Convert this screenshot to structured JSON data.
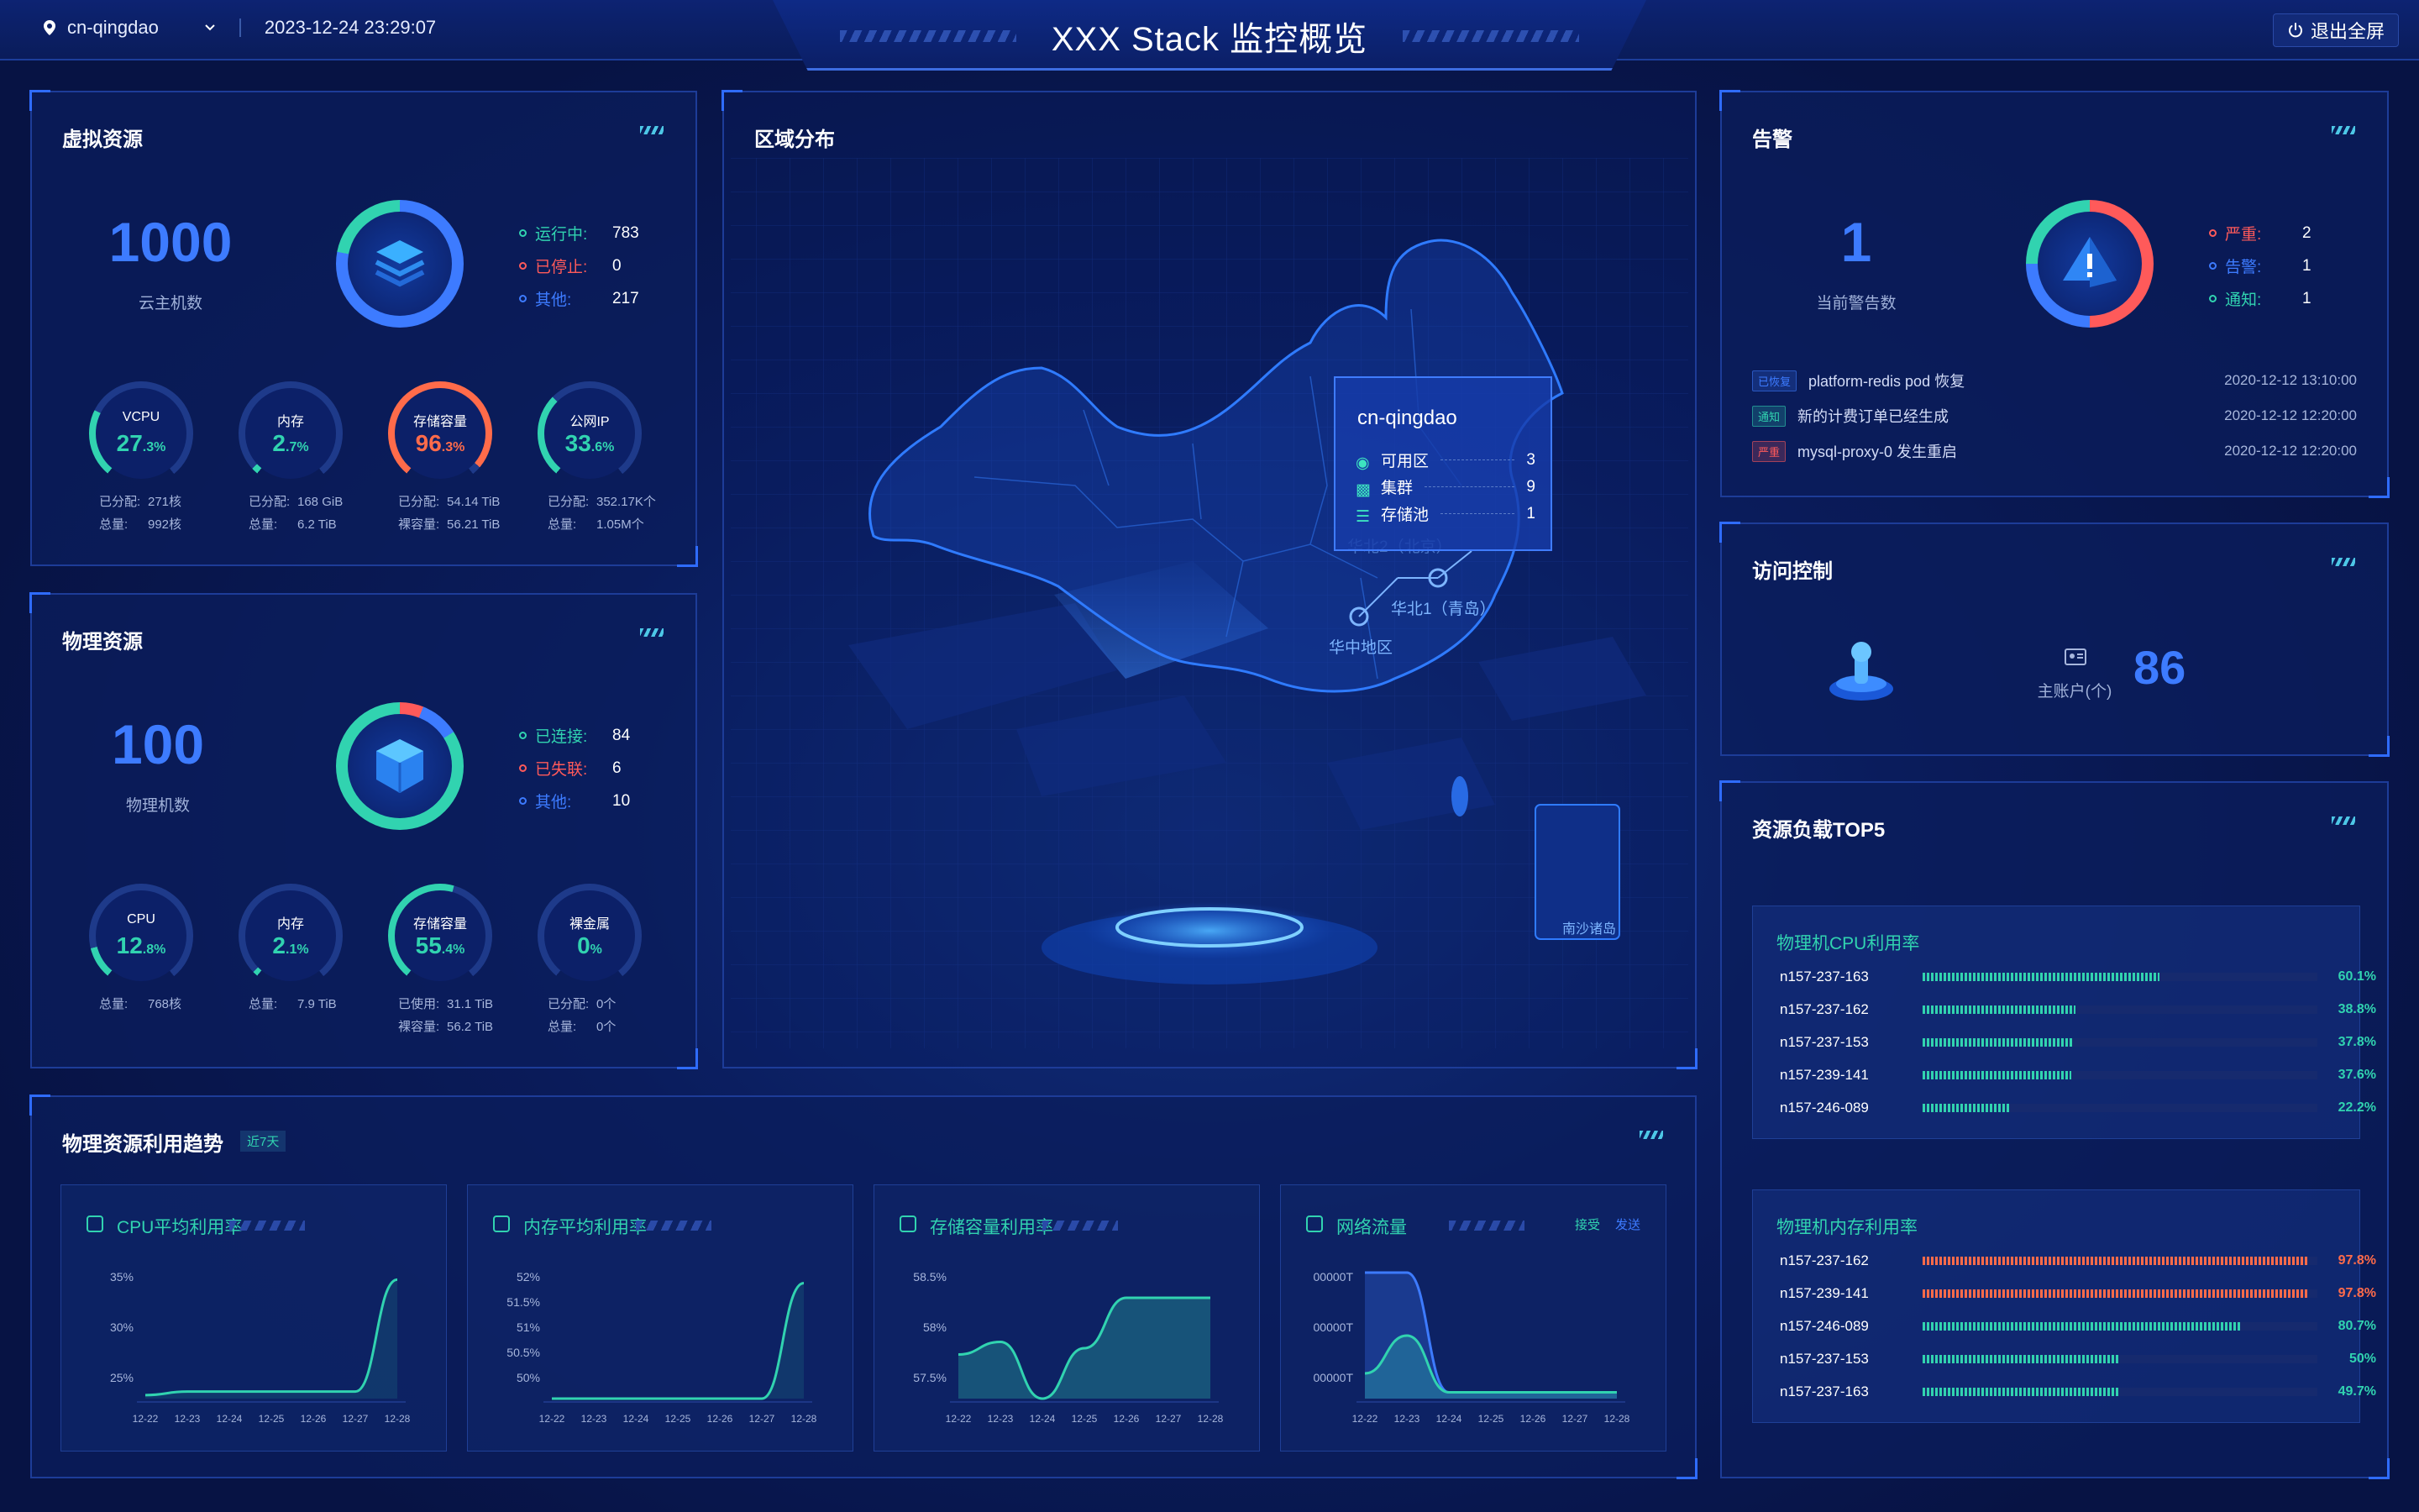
{
  "header": {
    "location": "cn-qingdao",
    "datetime": "2023-12-24 23:29:07",
    "title": "XXX Stack 监控概览",
    "exit_label": "退出全屏"
  },
  "virtual": {
    "title": "虚拟资源",
    "total": "1000",
    "total_caption": "云主机数",
    "stats": [
      {
        "label": "运行中:",
        "value": "783",
        "color": "#31d3b0"
      },
      {
        "label": "已停止:",
        "value": "0",
        "color": "#ff5a5a"
      },
      {
        "label": "其他:",
        "value": "217",
        "color": "#3d7bff"
      }
    ],
    "gauges": [
      {
        "label": "VCPU",
        "int": "27",
        "dec": ".3%",
        "pct": 27.3,
        "color": "#31d3b0",
        "n1k": "已分配:",
        "n1v": "271核",
        "n2k": "总量:",
        "n2v": "992核"
      },
      {
        "label": "内存",
        "int": "2",
        "dec": ".7%",
        "pct": 2.7,
        "color": "#31d3b0",
        "n1k": "已分配:",
        "n1v": "168 GiB",
        "n2k": "总量:",
        "n2v": "6.2 TiB"
      },
      {
        "label": "存储容量",
        "int": "96",
        "dec": ".3%",
        "pct": 96.3,
        "color": "#ff6b4a",
        "n1k": "已分配:",
        "n1v": "54.14 TiB",
        "n2k": "裸容量:",
        "n2v": "56.21 TiB"
      },
      {
        "label": "公网IP",
        "int": "33",
        "dec": ".6%",
        "pct": 33.6,
        "color": "#31d3b0",
        "n1k": "已分配:",
        "n1v": "352.17K个",
        "n2k": "总量:",
        "n2v": "1.05M个"
      }
    ]
  },
  "physical": {
    "title": "物理资源",
    "total": "100",
    "total_caption": "物理机数",
    "stats": [
      {
        "label": "已连接:",
        "value": "84",
        "color": "#31d3b0"
      },
      {
        "label": "已失联:",
        "value": "6",
        "color": "#ff5a5a"
      },
      {
        "label": "其他:",
        "value": "10",
        "color": "#3d7bff"
      }
    ],
    "gauges": [
      {
        "label": "CPU",
        "int": "12",
        "dec": ".8%",
        "pct": 12.8,
        "color": "#31d3b0",
        "n1k": "总量:",
        "n1v": "768核",
        "n2k": "",
        "n2v": ""
      },
      {
        "label": "内存",
        "int": "2",
        "dec": ".1%",
        "pct": 2.1,
        "color": "#31d3b0",
        "n1k": "总量:",
        "n1v": "7.9 TiB",
        "n2k": "",
        "n2v": ""
      },
      {
        "label": "存储容量",
        "int": "55",
        "dec": ".4%",
        "pct": 55.4,
        "color": "#31d3b0",
        "n1k": "已使用:",
        "n1v": "31.1 TiB",
        "n2k": "裸容量:",
        "n2v": "56.2 TiB"
      },
      {
        "label": "裸金属",
        "int": "0",
        "dec": "%",
        "pct": 0,
        "color": "#31d3b0",
        "n1k": "已分配:",
        "n1v": "0个",
        "n2k": "总量:",
        "n2v": "0个"
      }
    ]
  },
  "region": {
    "title": "区域分布",
    "tooltip": {
      "name": "cn-qingdao",
      "rows": [
        {
          "label": "可用区",
          "value": "3"
        },
        {
          "label": "集群",
          "value": "9"
        },
        {
          "label": "存储池",
          "value": "1"
        }
      ]
    },
    "labels": {
      "north2": "华北2（北京）",
      "north1": "华北1（青岛）",
      "central": "华中地区",
      "nansha": "南沙诸岛"
    }
  },
  "alarm": {
    "title": "告警",
    "total": "1",
    "total_caption": "当前警告数",
    "stats": [
      {
        "label": "严重:",
        "value": "2",
        "color": "#ff5a5a"
      },
      {
        "label": "告警:",
        "value": "1",
        "color": "#3d7bff"
      },
      {
        "label": "通知:",
        "value": "1",
        "color": "#31d3b0"
      }
    ],
    "list": [
      {
        "tag": "已恢复",
        "tagc": "#3d7bff",
        "text": "platform-redis pod 恢复",
        "time": "2020-12-12 13:10:00"
      },
      {
        "tag": "通知",
        "tagc": "#31d3b0",
        "text": "新的计费订单已经生成",
        "time": "2020-12-12 12:20:00"
      },
      {
        "tag": "严重",
        "tagc": "#ff5a5a",
        "text": "mysql-proxy-0 发生重启",
        "time": "2020-12-12 12:20:00"
      }
    ]
  },
  "access": {
    "title": "访问控制",
    "caption": "主账户(个)",
    "value": "86"
  },
  "top5": {
    "title": "资源负载TOP5",
    "cpu": {
      "title": "物理机CPU利用率",
      "rows": [
        {
          "name": "n157-237-163",
          "pct": "60.1%",
          "v": 60.1
        },
        {
          "name": "n157-237-162",
          "pct": "38.8%",
          "v": 38.8
        },
        {
          "name": "n157-237-153",
          "pct": "37.8%",
          "v": 37.8
        },
        {
          "name": "n157-239-141",
          "pct": "37.6%",
          "v": 37.6
        },
        {
          "name": "n157-246-089",
          "pct": "22.2%",
          "v": 22.2
        }
      ]
    },
    "mem": {
      "title": "物理机内存利用率",
      "rows": [
        {
          "name": "n157-237-162",
          "pct": "97.8%",
          "v": 97.8
        },
        {
          "name": "n157-239-141",
          "pct": "97.8%",
          "v": 97.8
        },
        {
          "name": "n157-246-089",
          "pct": "80.7%",
          "v": 80.7
        },
        {
          "name": "n157-237-153",
          "pct": "50%",
          "v": 50
        },
        {
          "name": "n157-237-163",
          "pct": "49.7%",
          "v": 49.7
        }
      ]
    }
  },
  "trend": {
    "title": "物理资源利用趋势",
    "badge": "近7天",
    "legend": {
      "recv": "接受",
      "send": "发送"
    },
    "chart_data": [
      {
        "type": "line",
        "title": "CPU平均利用率",
        "categories": [
          "12-22",
          "12-23",
          "12-24",
          "12-25",
          "12-26",
          "12-27",
          "12-28"
        ],
        "yticks": [
          "35%",
          "30%",
          "25%"
        ],
        "ylim": [
          20,
          38
        ],
        "series": [
          {
            "values": [
              20.5,
              21,
              21,
              21,
              21,
              21,
              37
            ]
          }
        ]
      },
      {
        "type": "line",
        "title": "内存平均利用率",
        "categories": [
          "12-22",
          "12-23",
          "12-24",
          "12-25",
          "12-26",
          "12-27",
          "12-28"
        ],
        "yticks": [
          "52%",
          "51.5%",
          "51%",
          "50.5%",
          "50%"
        ],
        "ylim": [
          49.8,
          52.2
        ],
        "series": [
          {
            "values": [
              49.8,
              49.8,
              49.8,
              49.8,
              49.8,
              49.8,
              52
            ]
          }
        ]
      },
      {
        "type": "area",
        "title": "存储容量利用率",
        "categories": [
          "12-22",
          "12-23",
          "12-24",
          "12-25",
          "12-26",
          "12-27",
          "12-28"
        ],
        "yticks": [
          "58.5%",
          "58%",
          "57.5%"
        ],
        "ylim": [
          57.2,
          59.2
        ],
        "series": [
          {
            "values": [
              57.9,
              58.1,
              57.2,
              58.0,
              58.8,
              58.8,
              58.8
            ]
          }
        ]
      },
      {
        "type": "area",
        "title": "网络流量",
        "categories": [
          "12-22",
          "12-23",
          "12-24",
          "12-25",
          "12-26",
          "12-27",
          "12-28"
        ],
        "yticks": [
          "00000T",
          "00000T",
          "00000T"
        ],
        "ylim": [
          0,
          100
        ],
        "series": [
          {
            "name": "接受",
            "values": [
              100,
              100,
              5,
              5,
              5,
              5,
              5
            ]
          },
          {
            "name": "发送",
            "values": [
              20,
              50,
              5,
              5,
              5,
              5,
              5
            ]
          }
        ]
      }
    ]
  }
}
